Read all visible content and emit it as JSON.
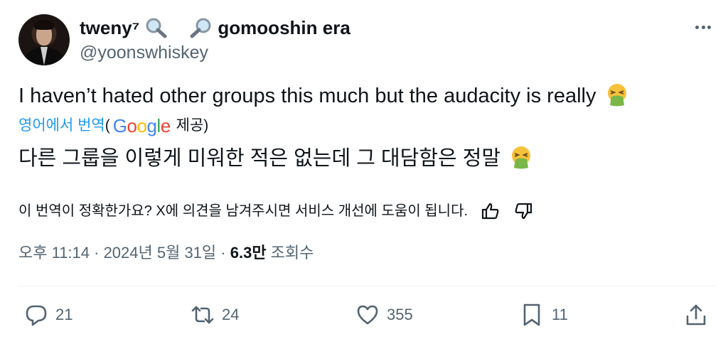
{
  "author": {
    "display_name_prefix": "tweny⁷",
    "display_name_suffix": "gomooshin era",
    "handle": "@yoonswhiskey"
  },
  "tweet": {
    "text": "I haven’t hated other groups this much but the audacity is really",
    "translate_link": "영어에서 번역",
    "paren_open": "(",
    "google": [
      "G",
      "o",
      "o",
      "g",
      "l",
      "e"
    ],
    "provided": "제공)",
    "translated_text": "다른 그룹을 이렇게 미워한 적은 없는데 그 대담함은 정말",
    "feedback_prompt": "이 번역이 정확한가요? X에 의견을 남겨주시면 서비스 개선에 도움이 됩니다."
  },
  "meta": {
    "timestamp": "오후 11:14 · 2024년 5월 31일",
    "separator": " · ",
    "views_count": "6.3만",
    "views_label": " 조회수"
  },
  "actions": {
    "replies": "21",
    "reposts": "24",
    "likes": "355",
    "bookmarks": "11"
  },
  "colors": {
    "link": "#1d9bf0",
    "secondary_text": "#536471",
    "primary_text": "#0f1419"
  },
  "icons": [
    "magnifying-glass-tilted-left-icon",
    "magnifying-glass-tilted-right-icon",
    "vomiting-face-emoji",
    "thumbs-up-icon",
    "thumbs-down-icon",
    "reply-icon",
    "repost-icon",
    "like-icon",
    "bookmark-icon",
    "share-icon",
    "more-icon"
  ]
}
